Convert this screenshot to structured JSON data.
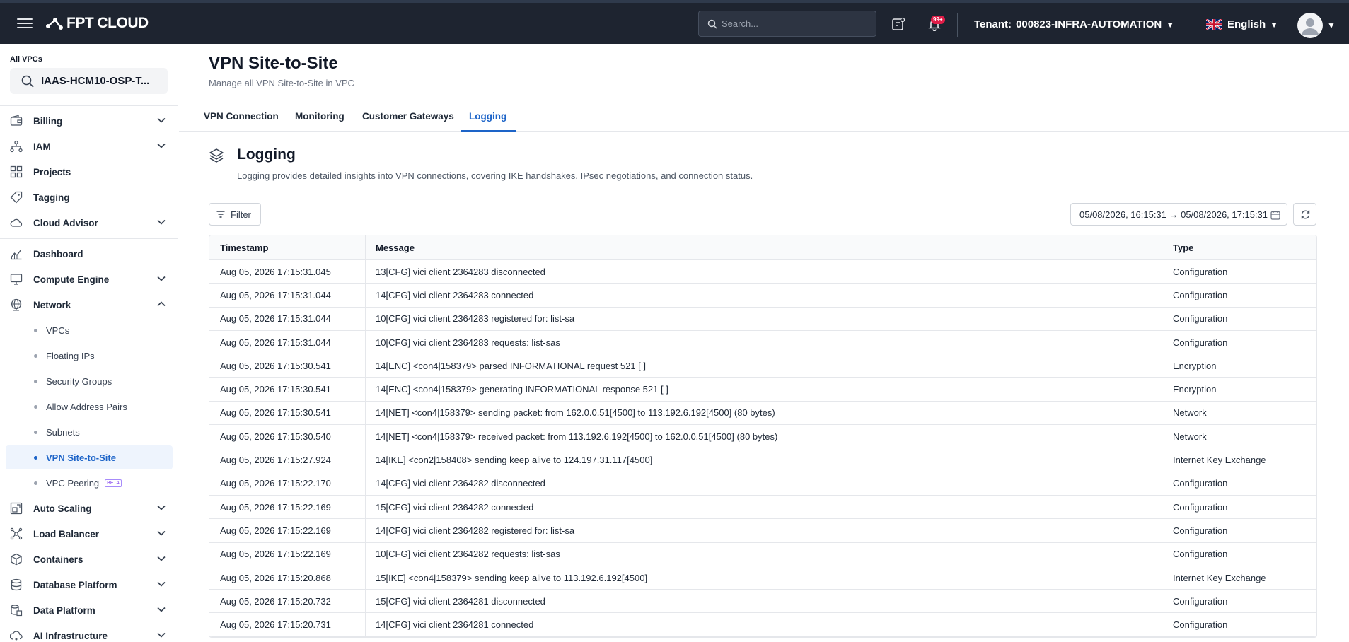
{
  "header": {
    "brand": "FPT CLOUD",
    "search_placeholder": "Search...",
    "notification_badge": "99+",
    "tenant_label": "Tenant:",
    "tenant_value": "000823-INFRA-AUTOMATION",
    "language": "English"
  },
  "sidebar": {
    "vpc_label": "All VPCs",
    "vpc_selected": "IAAS-HCM10-OSP-T...",
    "items": [
      {
        "label": "Billing",
        "icon": "wallet-icon"
      },
      {
        "label": "IAM",
        "icon": "hierarchy-icon"
      },
      {
        "label": "Projects",
        "icon": "grid-icon"
      },
      {
        "label": "Tagging",
        "icon": "tag-icon"
      },
      {
        "label": "Cloud Advisor",
        "icon": "cloud-icon"
      },
      {
        "label": "Dashboard",
        "icon": "chart-icon"
      },
      {
        "label": "Compute Engine",
        "icon": "monitor-icon"
      },
      {
        "label": "Network",
        "icon": "globe-icon"
      },
      {
        "label": "Auto Scaling",
        "icon": "scaling-icon"
      },
      {
        "label": "Load Balancer",
        "icon": "network-icon"
      },
      {
        "label": "Containers",
        "icon": "box-icon"
      },
      {
        "label": "Database Platform",
        "icon": "database-icon"
      },
      {
        "label": "Data Platform",
        "icon": "data-icon"
      },
      {
        "label": "AI Infrastructure",
        "icon": "ai-icon"
      }
    ],
    "network_sub": [
      {
        "label": "VPCs"
      },
      {
        "label": "Floating IPs"
      },
      {
        "label": "Security Groups"
      },
      {
        "label": "Allow Address Pairs"
      },
      {
        "label": "Subnets"
      },
      {
        "label": "VPN Site-to-Site"
      },
      {
        "label": "VPC Peering",
        "badge": "BETA"
      }
    ]
  },
  "page": {
    "title": "VPN Site-to-Site",
    "subtitle": "Manage all VPN Site-to-Site in VPC",
    "tabs": [
      "VPN Connection",
      "Monitoring",
      "Customer Gateways",
      "Logging"
    ],
    "active_tab": "Logging"
  },
  "logging": {
    "title": "Logging",
    "description": "Logging provides detailed insights into VPN connections, covering IKE handshakes, IPsec negotiations, and connection status.",
    "filter_label": "Filter",
    "date_range": "05/08/2026, 16:15:31 → 05/08/2026, 17:15:31"
  },
  "table": {
    "headers": [
      "Timestamp",
      "Message",
      "Type"
    ],
    "rows": [
      {
        "ts": "Aug 05, 2026 17:15:31.045",
        "msg": "13[CFG] vici client 2364283 disconnected",
        "type": "Configuration"
      },
      {
        "ts": "Aug 05, 2026 17:15:31.044",
        "msg": "14[CFG] vici client 2364283 connected",
        "type": "Configuration"
      },
      {
        "ts": "Aug 05, 2026 17:15:31.044",
        "msg": "10[CFG] vici client 2364283 registered for: list-sa",
        "type": "Configuration"
      },
      {
        "ts": "Aug 05, 2026 17:15:31.044",
        "msg": "10[CFG] vici client 2364283 requests: list-sas",
        "type": "Configuration"
      },
      {
        "ts": "Aug 05, 2026 17:15:30.541",
        "msg": "14[ENC] <con4|158379> parsed INFORMATIONAL request 521 [ ]",
        "type": "Encryption"
      },
      {
        "ts": "Aug 05, 2026 17:15:30.541",
        "msg": "14[ENC] <con4|158379> generating INFORMATIONAL response 521 [ ]",
        "type": "Encryption"
      },
      {
        "ts": "Aug 05, 2026 17:15:30.541",
        "msg": "14[NET] <con4|158379> sending packet: from 162.0.0.51[4500] to 113.192.6.192[4500] (80 bytes)",
        "type": "Network"
      },
      {
        "ts": "Aug 05, 2026 17:15:30.540",
        "msg": "14[NET] <con4|158379> received packet: from 113.192.6.192[4500] to 162.0.0.51[4500] (80 bytes)",
        "type": "Network"
      },
      {
        "ts": "Aug 05, 2026 17:15:27.924",
        "msg": "14[IKE] <con2|158408> sending keep alive to 124.197.31.117[4500]",
        "type": "Internet Key Exchange"
      },
      {
        "ts": "Aug 05, 2026 17:15:22.170",
        "msg": "14[CFG] vici client 2364282 disconnected",
        "type": "Configuration"
      },
      {
        "ts": "Aug 05, 2026 17:15:22.169",
        "msg": "15[CFG] vici client 2364282 connected",
        "type": "Configuration"
      },
      {
        "ts": "Aug 05, 2026 17:15:22.169",
        "msg": "14[CFG] vici client 2364282 registered for: list-sa",
        "type": "Configuration"
      },
      {
        "ts": "Aug 05, 2026 17:15:22.169",
        "msg": "10[CFG] vici client 2364282 requests: list-sas",
        "type": "Configuration"
      },
      {
        "ts": "Aug 05, 2026 17:15:20.868",
        "msg": "15[IKE] <con4|158379> sending keep alive to 113.192.6.192[4500]",
        "type": "Internet Key Exchange"
      },
      {
        "ts": "Aug 05, 2026 17:15:20.732",
        "msg": "15[CFG] vici client 2364281 disconnected",
        "type": "Configuration"
      },
      {
        "ts": "Aug 05, 2026 17:15:20.731",
        "msg": "14[CFG] vici client 2364281 connected",
        "type": "Configuration"
      }
    ]
  }
}
